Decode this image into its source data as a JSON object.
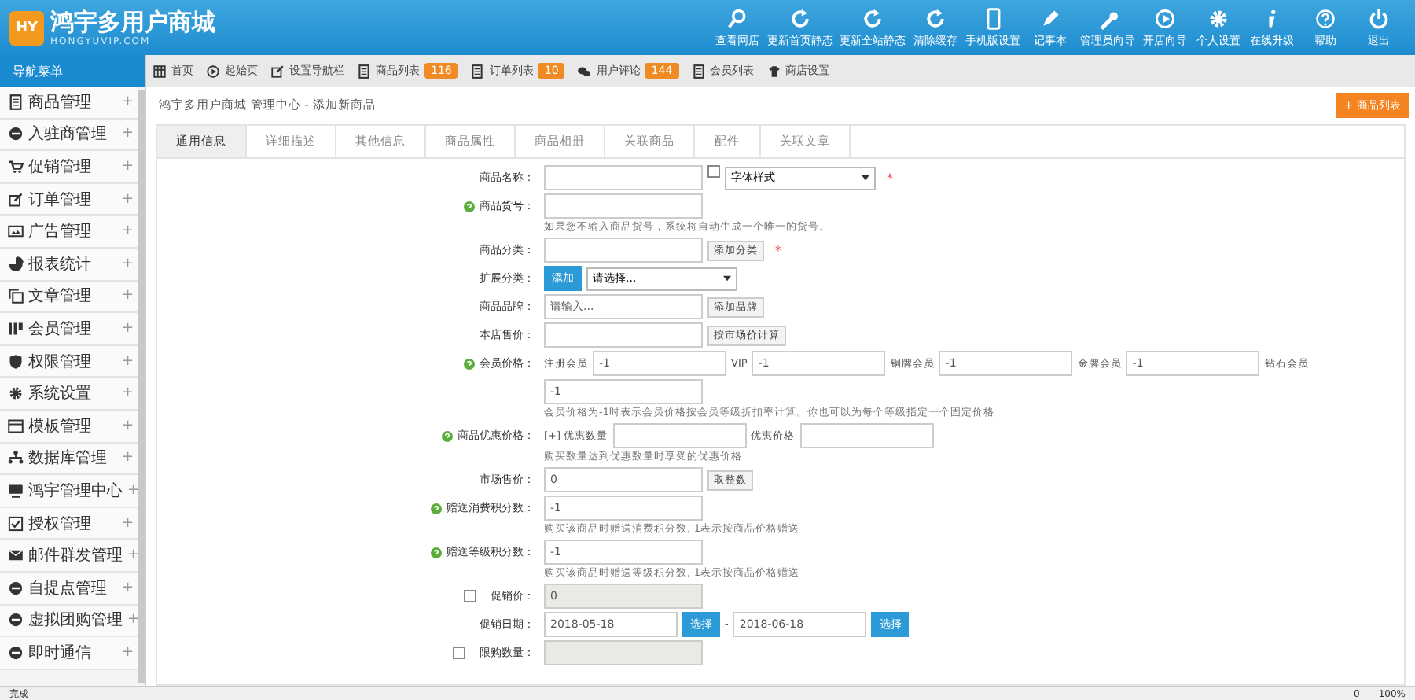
{
  "logo": {
    "title": "鸿宇多用户商城",
    "subtitle": "HONGYUVIP.COM",
    "mark": "HY"
  },
  "header_actions": [
    {
      "label": "查看网店"
    },
    {
      "label": "更新首页静态"
    },
    {
      "label": "更新全站静态"
    },
    {
      "label": "清除缓存"
    },
    {
      "label": "手机版设置"
    },
    {
      "label": "记事本"
    },
    {
      "label": "管理员向导"
    },
    {
      "label": "开店向导"
    },
    {
      "label": "个人设置"
    },
    {
      "label": "在线升级"
    },
    {
      "label": "帮助"
    },
    {
      "label": "退出"
    }
  ],
  "nav_title": "导航菜单",
  "toolbar": [
    {
      "label": "首页"
    },
    {
      "label": "起始页"
    },
    {
      "label": "设置导航栏"
    },
    {
      "label": "商品列表",
      "badge": "116"
    },
    {
      "label": "订单列表",
      "badge": "10"
    },
    {
      "label": "用户评论",
      "badge": "144"
    },
    {
      "label": "会员列表"
    },
    {
      "label": "商店设置"
    }
  ],
  "sidebar": {
    "items": [
      {
        "label": "商品管理"
      },
      {
        "label": "入驻商管理"
      },
      {
        "label": "促销管理"
      },
      {
        "label": "订单管理"
      },
      {
        "label": "广告管理"
      },
      {
        "label": "报表统计"
      },
      {
        "label": "文章管理"
      },
      {
        "label": "会员管理"
      },
      {
        "label": "权限管理"
      },
      {
        "label": "系统设置"
      },
      {
        "label": "模板管理"
      },
      {
        "label": "数据库管理"
      },
      {
        "label": "鸿宇管理中心"
      },
      {
        "label": "授权管理"
      },
      {
        "label": "邮件群发管理"
      },
      {
        "label": "自提点管理"
      },
      {
        "label": "虚拟团购管理"
      },
      {
        "label": "即时通信"
      }
    ],
    "expand": "+"
  },
  "breadcrumb": "鸿宇多用户商城 管理中心 - 添加新商品",
  "list_button": "+ 商品列表",
  "tabs": [
    {
      "label": "通用信息",
      "selected": true
    },
    {
      "label": "详细描述",
      "selected": false
    },
    {
      "label": "其他信息",
      "selected": false
    },
    {
      "label": "商品属性",
      "selected": false
    },
    {
      "label": "商品相册",
      "selected": false
    },
    {
      "label": "关联商品",
      "selected": false
    },
    {
      "label": "配件",
      "selected": false
    },
    {
      "label": "关联文章",
      "selected": false
    }
  ],
  "form": [
    {
      "label": "商品名称：",
      "tip": false,
      "parts": [
        {
          "kind": "input"
        },
        {
          "kind": "swatch"
        },
        {
          "kind": "select",
          "value": "字体样式"
        },
        {
          "kind": "required",
          "text": "*"
        }
      ]
    },
    {
      "label": "商品货号：",
      "tip": true,
      "parts": [
        {
          "kind": "input"
        }
      ],
      "note": "如果您不输入商品货号，系统将自动生成一个唯一的货号。"
    },
    {
      "label": "商品分类：",
      "tip": false,
      "parts": [
        {
          "kind": "input"
        },
        {
          "kind": "button",
          "text": "添加分类"
        },
        {
          "kind": "required",
          "text": "*"
        }
      ]
    },
    {
      "label": "扩展分类：",
      "tip": false,
      "parts": [
        {
          "kind": "action",
          "text": "添加"
        },
        {
          "kind": "select",
          "value": "请选择..."
        }
      ]
    },
    {
      "label": "商品品牌：",
      "tip": false,
      "parts": [
        {
          "kind": "input",
          "value": "请输入..."
        },
        {
          "kind": "button",
          "text": "添加品牌"
        }
      ]
    },
    {
      "label": "本店售价：",
      "tip": false,
      "parts": [
        {
          "kind": "input"
        },
        {
          "kind": "button",
          "text": "按市场价计算"
        }
      ]
    },
    {
      "label": "会员价格：",
      "tip": true,
      "parts": [
        {
          "kind": "text",
          "text": "注册会员"
        },
        {
          "kind": "input",
          "value": "-1"
        },
        {
          "kind": "text",
          "text": "VIP"
        },
        {
          "kind": "input",
          "value": "-1"
        },
        {
          "kind": "text",
          "text": "铜牌会员"
        },
        {
          "kind": "input",
          "value": "-1"
        },
        {
          "kind": "text",
          "text": "金牌会员"
        },
        {
          "kind": "input",
          "value": "-1"
        },
        {
          "kind": "text",
          "text": "钻石会员"
        }
      ]
    },
    {
      "tip": false,
      "parts": [
        {
          "kind": "input",
          "value": "-1"
        }
      ],
      "note": "会员价格为-1时表示会员价格按会员等级折扣率计算。你也可以为每个等级指定一个固定价格"
    },
    {
      "label": "商品优惠价格：",
      "tip": true,
      "parts": [
        {
          "kind": "text",
          "text": "[+] 优惠数量"
        },
        {
          "kind": "input"
        },
        {
          "kind": "text",
          "text": "优惠价格"
        },
        {
          "kind": "input"
        }
      ],
      "note": "购买数量达到优惠数量时享受的优惠价格"
    },
    {
      "label": "市场售价：",
      "tip": false,
      "parts": [
        {
          "kind": "input",
          "value": "0"
        },
        {
          "kind": "button",
          "text": "取整数"
        }
      ]
    },
    {
      "label": "赠送消费积分数：",
      "tip": true,
      "parts": [
        {
          "kind": "input",
          "value": "-1"
        }
      ],
      "note": "购买该商品时赠送消费积分数,-1表示按商品价格赠送"
    },
    {
      "label": "赠送等级积分数：",
      "tip": true,
      "parts": [
        {
          "kind": "input",
          "value": "-1"
        }
      ],
      "note": "购买该商品时赠送等级积分数,-1表示按商品价格赠送"
    },
    {
      "label": "促销价：",
      "tip": false,
      "checked": false,
      "parts": [
        {
          "kind": "input",
          "value": "0",
          "disabled": true
        }
      ]
    },
    {
      "label": "促销日期：",
      "tip": false,
      "parts": [
        {
          "kind": "input",
          "value": "2018-05-18"
        },
        {
          "kind": "action",
          "text": "选择"
        },
        {
          "kind": "text",
          "text": "-"
        },
        {
          "kind": "input",
          "value": "2018-06-18"
        },
        {
          "kind": "action",
          "text": "选择"
        }
      ]
    },
    {
      "label": "限购数量：",
      "tip": false,
      "checked": false,
      "parts": [
        {
          "kind": "input",
          "disabled": true
        }
      ]
    }
  ],
  "status": {
    "text": "完成",
    "count": "0",
    "zoom": "100%"
  }
}
